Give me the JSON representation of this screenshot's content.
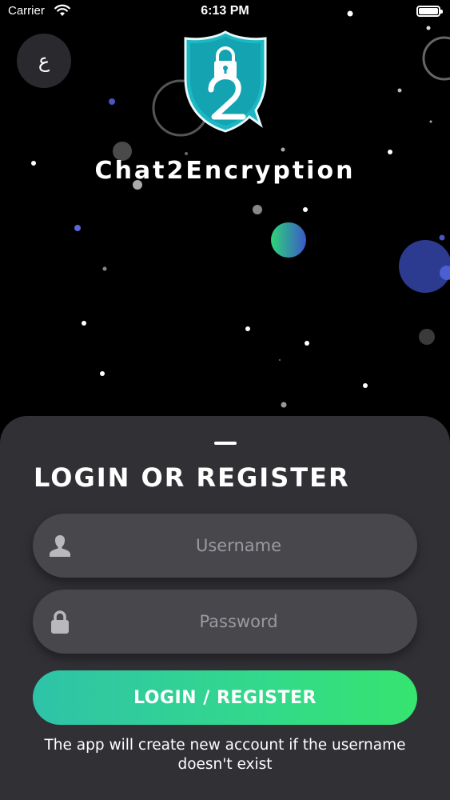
{
  "status_bar": {
    "carrier": "Carrier",
    "time": "6:13 PM"
  },
  "header": {
    "language_toggle": "ع",
    "app_title": "Chat2Encryption"
  },
  "login_sheet": {
    "title": "LOGIN OR REGISTER",
    "username_placeholder": "Username",
    "password_placeholder": "Password",
    "submit_label": "LOGIN / REGISTER",
    "note": "The app will create new account if the username doesn't exist"
  },
  "colors": {
    "accent_start": "#2ec3a8",
    "accent_end": "#36e46f",
    "logo": "#1bb8c4",
    "sheet": "#303035"
  },
  "icons": [
    "wifi-icon",
    "battery-icon",
    "shield-lock-logo-icon",
    "user-icon",
    "lock-icon"
  ]
}
